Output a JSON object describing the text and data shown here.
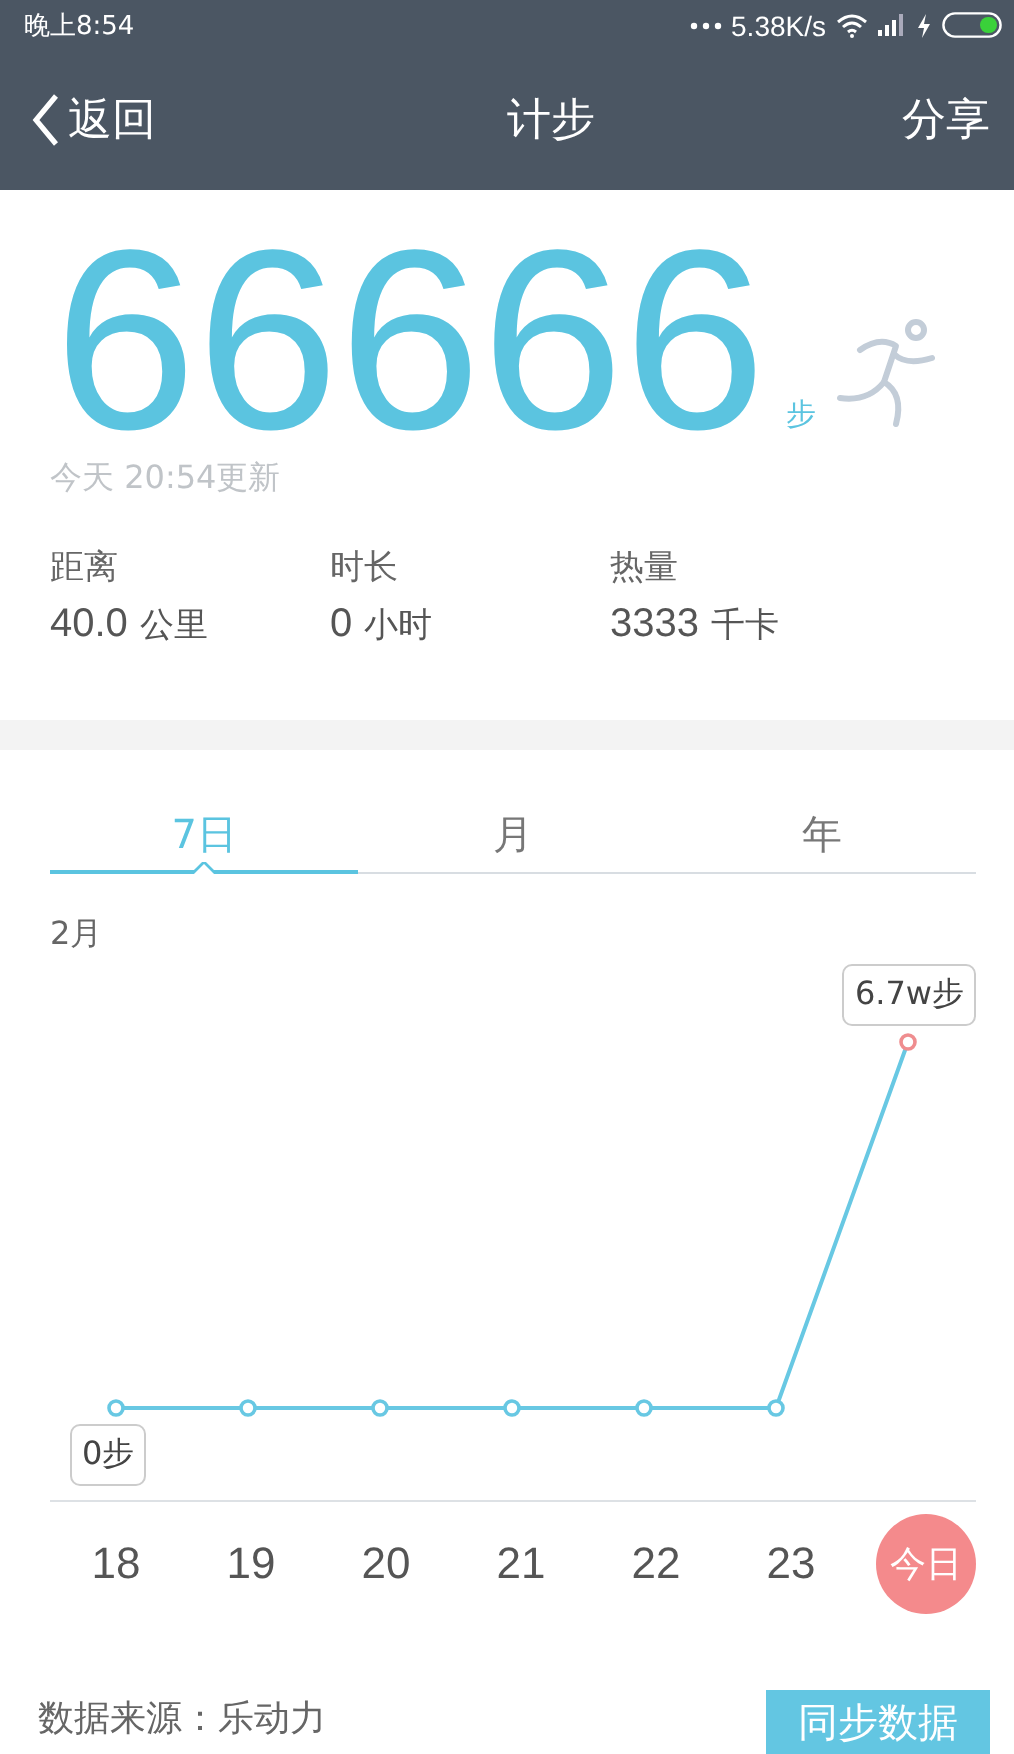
{
  "status_bar": {
    "time": "晚上8:54",
    "speed": "5.38K/s"
  },
  "nav": {
    "back": "返回",
    "title": "计步",
    "action": "分享"
  },
  "summary": {
    "steps": "66666",
    "unit": "步",
    "updated": "今天 20:54更新"
  },
  "stats": [
    {
      "label": "距离",
      "value": "40.0",
      "unit": "公里"
    },
    {
      "label": "时长",
      "value": "0",
      "unit": "小时"
    },
    {
      "label": "热量",
      "value": "3333",
      "unit": "千卡"
    }
  ],
  "tabs": [
    {
      "label": "7日",
      "selected": true
    },
    {
      "label": "月",
      "selected": false
    },
    {
      "label": "年",
      "selected": false
    }
  ],
  "chart": {
    "month": "2月",
    "low_label": "0步",
    "high_label": "6.7w步",
    "days": [
      {
        "label": "18",
        "selected": false
      },
      {
        "label": "19",
        "selected": false
      },
      {
        "label": "20",
        "selected": false
      },
      {
        "label": "21",
        "selected": false
      },
      {
        "label": "22",
        "selected": false
      },
      {
        "label": "23",
        "selected": false
      },
      {
        "label": "今日",
        "selected": true
      }
    ]
  },
  "footer": {
    "source": "数据来源：乐动力",
    "sync": "同步数据"
  }
}
